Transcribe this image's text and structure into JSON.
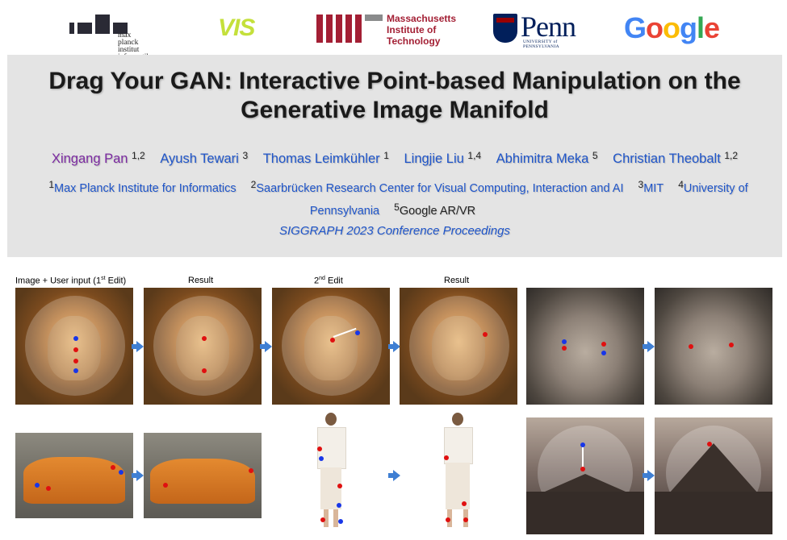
{
  "logos": {
    "mpi_line1": "max planck institut",
    "mpi_line2": "informatik",
    "vis": "VIS",
    "mit_line1": "Massachusetts",
    "mit_line2": "Institute of",
    "mit_line3": "Technology",
    "penn": "Penn",
    "penn_sub": "UNIVERSITY of PENNSYLVANIA",
    "google": "Google"
  },
  "title_line1": "Drag Your GAN: Interactive Point-based Manipulation on the",
  "title_line2": "Generative Image Manifold",
  "authors": [
    {
      "name": "Xingang Pan",
      "sup": "1,2"
    },
    {
      "name": "Ayush Tewari",
      "sup": "3"
    },
    {
      "name": "Thomas Leimkühler",
      "sup": "1"
    },
    {
      "name": "Lingjie Liu",
      "sup": "1,4"
    },
    {
      "name": "Abhimitra Meka",
      "sup": "5"
    },
    {
      "name": "Christian Theobalt",
      "sup": "1,2"
    }
  ],
  "affiliations": [
    {
      "num": "1",
      "name": "Max Planck Institute for Informatics"
    },
    {
      "num": "2",
      "name": "Saarbrücken Research Center for Visual Computing, Interaction and AI"
    },
    {
      "num": "3",
      "name": "MIT"
    },
    {
      "num": "4",
      "name": "University of Pennsylvania"
    },
    {
      "num": "5",
      "name": "Google AR/VR"
    }
  ],
  "venue": "SIGGRAPH 2023 Conference Proceedings",
  "captions": {
    "c1_main": "Image + User input (1",
    "c1_sup": "st",
    "c1_end": " Edit)",
    "c2": "Result",
    "c3_num": "2",
    "c3_sup": "nd",
    "c3_end": " Edit",
    "c4": "Result"
  },
  "colors": {
    "header_bg": "#e4e4e4",
    "link_blue": "#1f55c9",
    "first_author_purple": "#7b2aa1",
    "arrow_blue": "#3f7fd3",
    "handle_red": "#e01010",
    "target_blue": "#1836e8"
  }
}
